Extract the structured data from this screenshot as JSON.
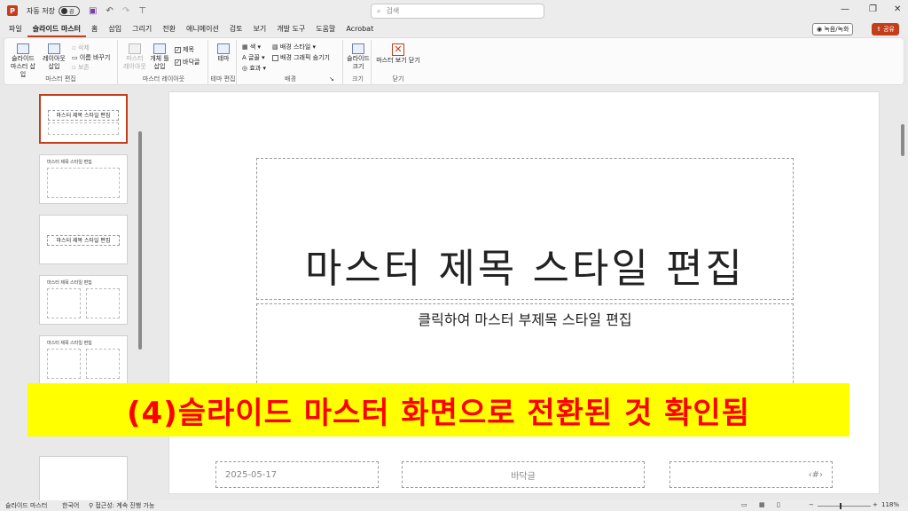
{
  "titlebar": {
    "autosave_label": "자동 저장",
    "autosave_state": "끔",
    "search_placeholder": "검색"
  },
  "menu": {
    "items": [
      "파일",
      "슬라이드 마스터",
      "홈",
      "삽입",
      "그리기",
      "전환",
      "애니메이션",
      "검토",
      "보기",
      "개발 도구",
      "도움말",
      "Acrobat"
    ],
    "record_label": "녹음/녹화",
    "share_label": "공유"
  },
  "ribbon": {
    "insert_slide_master": "슬라이드 마스터 삽입",
    "insert_layout": "레이아웃 삽입",
    "delete": "삭제",
    "rename": "이름 바꾸기",
    "preserve": "보존",
    "group_master_edit": "마스터 편집",
    "master_layout": "마스터 레이아웃",
    "insert_placeholder": "개체 틀 삽입",
    "title_check": "제목",
    "footer_check": "바닥글",
    "group_master_layout": "마스터 레이아웃",
    "theme": "테마",
    "group_theme_edit": "테마 편집",
    "colors": "색",
    "fonts": "글꼴",
    "effects": "효과",
    "background_styles": "배경 스타일",
    "hide_background": "배경 그래픽 숨기기",
    "group_background": "배경",
    "slide_size": "슬라이드 크기",
    "group_size": "크기",
    "close_master_view": "마스터 보기 닫기",
    "group_close": "닫기"
  },
  "thumbnails": [
    {
      "title": "마스터 제목 스타일 편집"
    },
    {
      "title": "마스터 제목 스타일 편집"
    },
    {
      "title": "마스터 제목 스타일 편집"
    },
    {
      "title": "마스터 제목 스타일 편집"
    },
    {
      "title": "마스터 제목 스타일 편집"
    }
  ],
  "slide": {
    "title": "마스터 제목 스타일 편집",
    "subtitle": "클릭하여 마스터 부제목 스타일 편집",
    "footer_date": "2025-05-17",
    "footer_text": "바닥글",
    "footer_number": "‹#›"
  },
  "caption": "(4)슬라이드 마스터 화면으로 전환된 것 확인됨",
  "statusbar": {
    "view": "슬라이드 마스터",
    "language": "한국어",
    "accessibility": "접근성: 계속 진행 가능",
    "zoom": "118%"
  },
  "colors": {
    "accent": "#c43e1c",
    "caption_bg": "#ffff00",
    "caption_text": "#ff0000"
  }
}
